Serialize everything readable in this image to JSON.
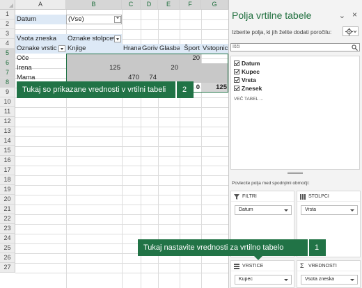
{
  "sheet": {
    "columns": [
      "A",
      "B",
      "C",
      "D",
      "E",
      "F",
      "G"
    ],
    "rows": [
      "1",
      "2",
      "3",
      "4",
      "5",
      "6",
      "7",
      "8",
      "9",
      "10",
      "11",
      "12",
      "13",
      "14",
      "15",
      "16",
      "17",
      "18",
      "19",
      "20",
      "21",
      "22",
      "23",
      "24",
      "25",
      "26",
      "27"
    ],
    "cells": {
      "a1": "Datum",
      "b1": "(Vse)",
      "a3": "Vsota zneska",
      "b3": "Oznake stolpcev",
      "a4": "Oznake vrstic",
      "b4": "Knjige",
      "c4": "Hrana",
      "d4": "Gorivo",
      "e4": "Glasba",
      "f4": "Šport",
      "g4": "Vstopnic",
      "a5": "Oče",
      "f5": "20",
      "a6": "Irena",
      "b6": "125",
      "e6": "20",
      "a7": "Mama",
      "c7": "470",
      "d7": "74",
      "f8": "0",
      "g8": "125"
    },
    "callout_values": {
      "text": "Tukaj so prikazane vrednosti v vrtilni tabeli",
      "number": "2"
    },
    "callout_settings": {
      "text": "Tukaj nastavite vrednosti za vrtilno tabelo",
      "number": "1"
    },
    "accent_color": "#217346"
  },
  "pane": {
    "title": "Polja vrtilne tabele",
    "subtitle": "Izberite polja, ki jih želite dodati poročilu:",
    "search_placeholder": "Išči",
    "fields": [
      {
        "label": "Datum",
        "checked": true
      },
      {
        "label": "Kupec",
        "checked": true
      },
      {
        "label": "Vrsta",
        "checked": true
      },
      {
        "label": "Znesek",
        "checked": true
      }
    ],
    "more_tables": "VEČ TABEL ...",
    "areas_note": "Povlecite polja med spodnjimi območji:",
    "areas": {
      "filters": {
        "label": "FILTRI",
        "chip": "Datum"
      },
      "columns": {
        "label": "STOLPCI",
        "chip": "Vrsta"
      },
      "rows": {
        "label": "VRSTICE",
        "chip": "Kupec"
      },
      "values": {
        "label": "VREDNOSTI",
        "chip": "Vsota zneska"
      }
    }
  }
}
